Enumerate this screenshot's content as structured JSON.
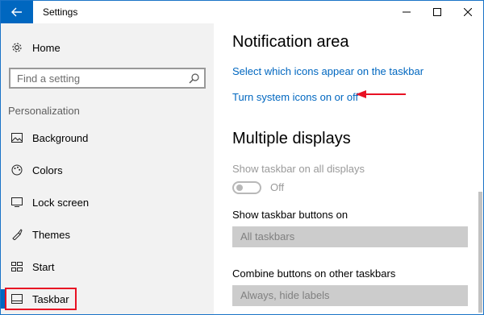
{
  "window": {
    "title": "Settings"
  },
  "sidebar": {
    "home_label": "Home",
    "search_placeholder": "Find a setting",
    "section_label": "Personalization",
    "items": [
      {
        "label": "Background",
        "icon": "picture-icon"
      },
      {
        "label": "Colors",
        "icon": "palette-icon"
      },
      {
        "label": "Lock screen",
        "icon": "lock-screen-icon"
      },
      {
        "label": "Themes",
        "icon": "brush-icon"
      },
      {
        "label": "Start",
        "icon": "start-grid-icon"
      },
      {
        "label": "Taskbar",
        "icon": "taskbar-icon",
        "selected": true
      }
    ]
  },
  "content": {
    "notification_area": {
      "heading": "Notification area",
      "link_icons": "Select which icons appear on the taskbar",
      "link_system_icons": "Turn system icons on or off"
    },
    "multiple_displays": {
      "heading": "Multiple displays",
      "show_all_label": "Show taskbar on all displays",
      "show_all_toggle_state": "Off",
      "show_buttons_label": "Show taskbar buttons on",
      "show_buttons_value": "All taskbars",
      "combine_label": "Combine buttons on other taskbars",
      "combine_value": "Always, hide labels"
    }
  },
  "colors": {
    "accent": "#0067c0",
    "highlight": "#e81123",
    "sidebar_bg": "#f2f2f2"
  }
}
